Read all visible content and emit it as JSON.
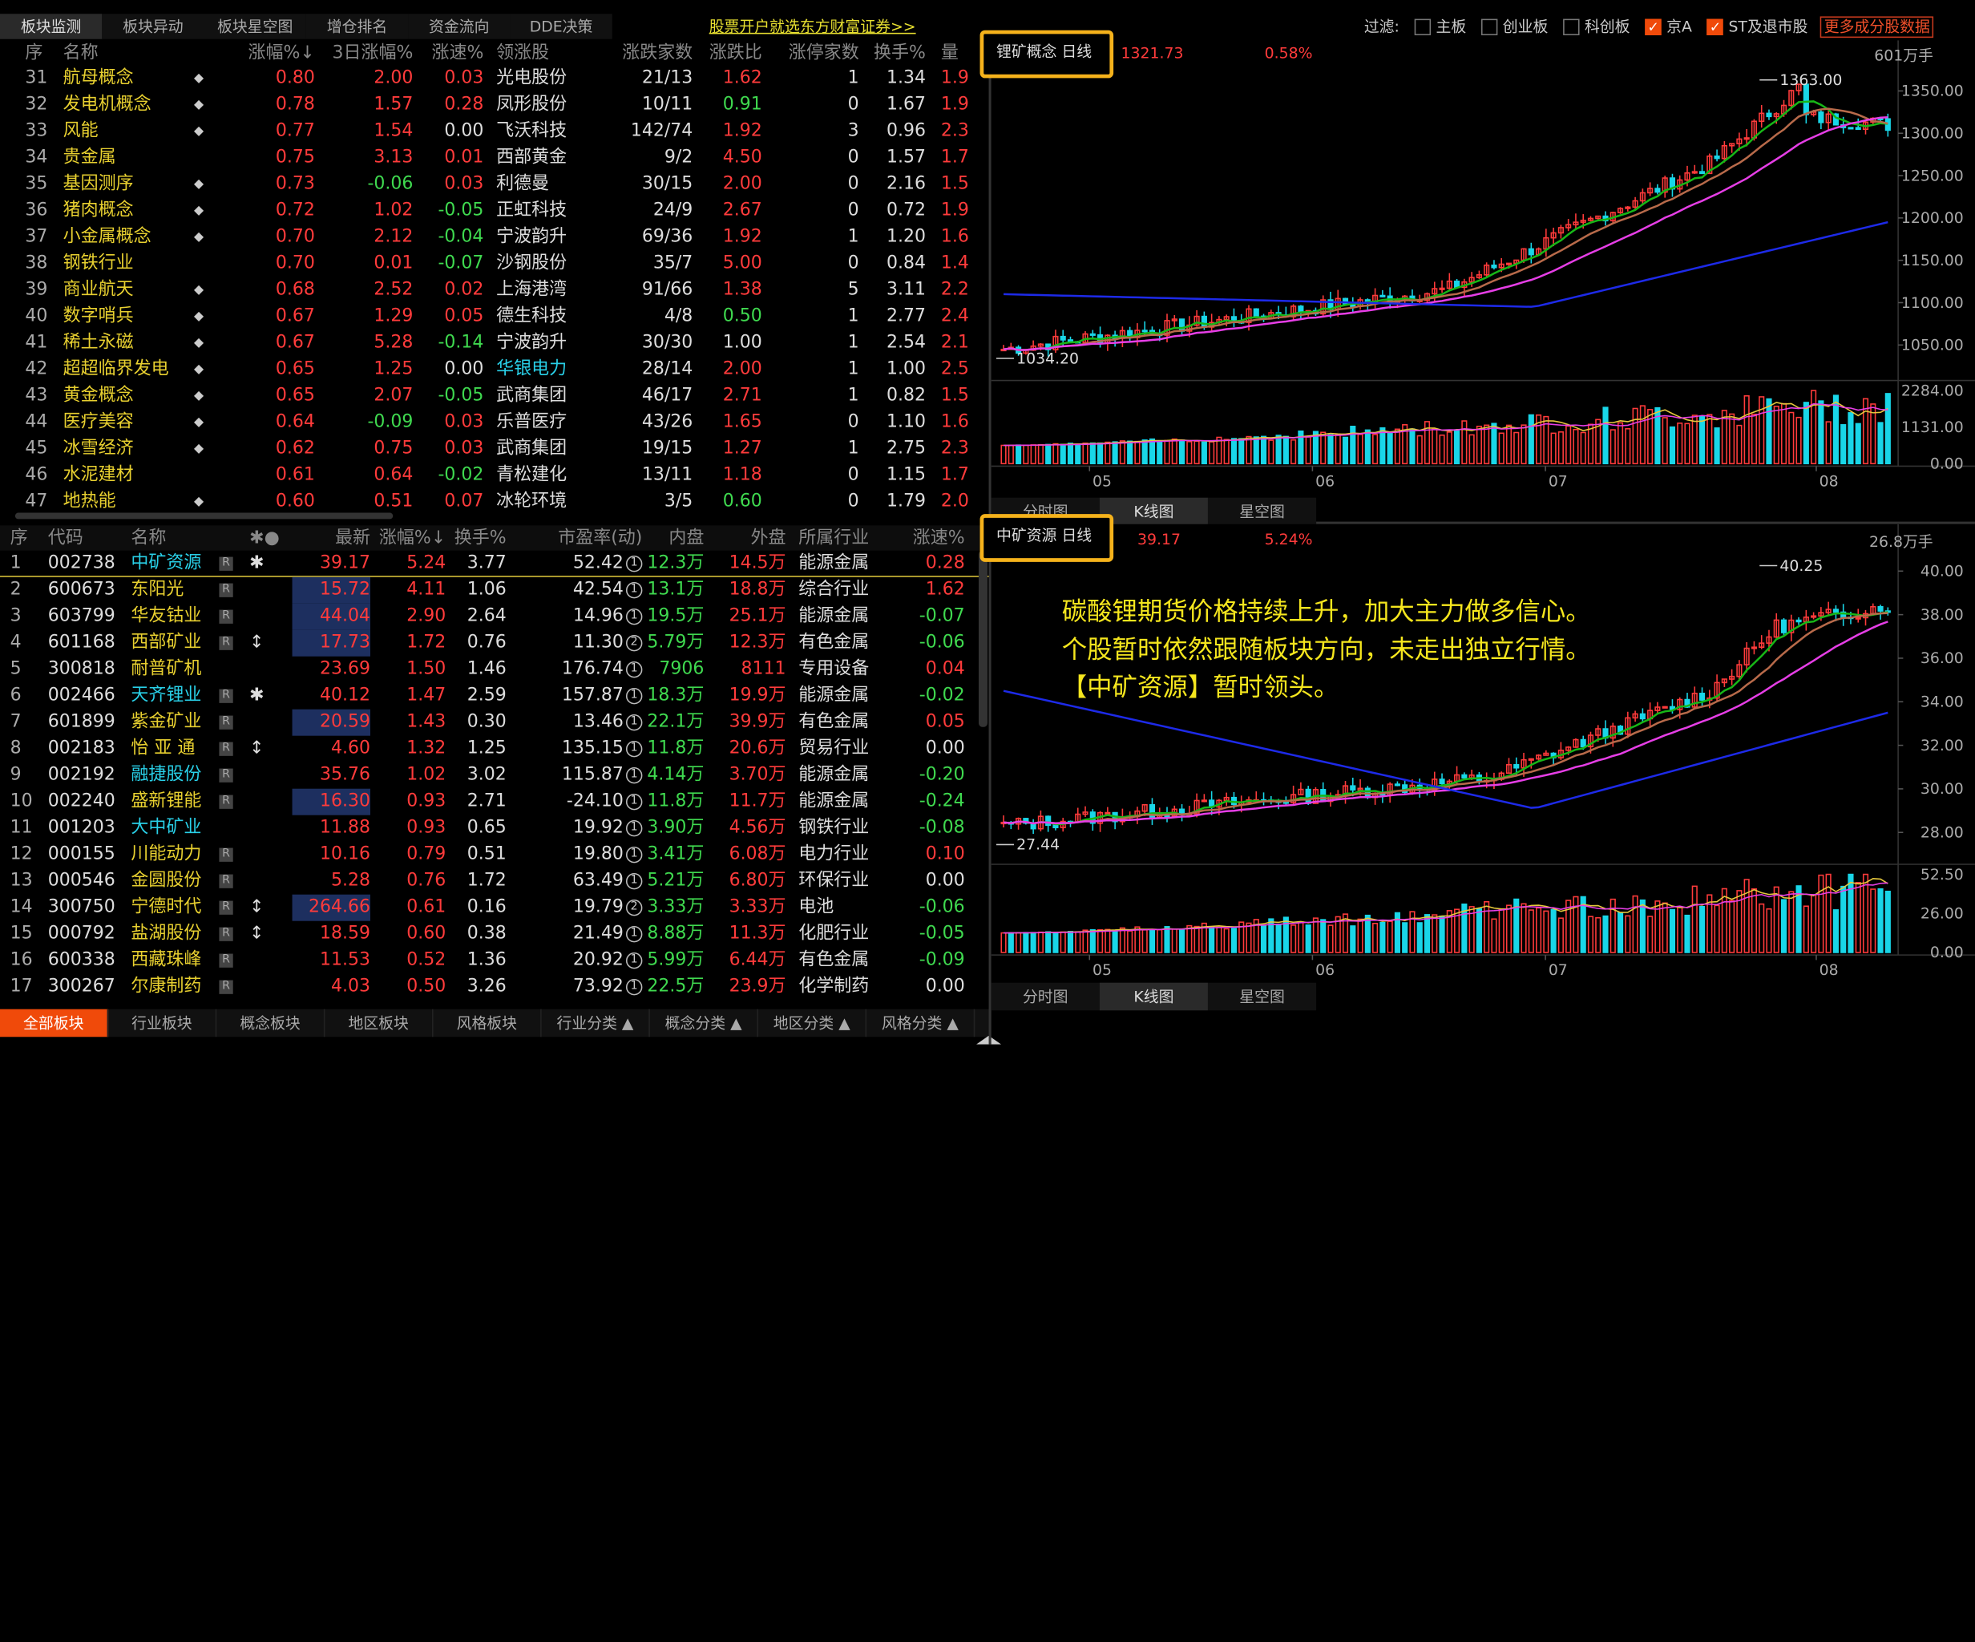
{
  "tabs": [
    "板块监测",
    "板块异动",
    "板块星空图",
    "增仓排名",
    "资金流向",
    "DDE决策"
  ],
  "promo": "股票开户就选东方财富证券>>",
  "filter": {
    "label": "过滤:",
    "items": [
      {
        "label": "主板",
        "checked": false
      },
      {
        "label": "创业板",
        "checked": false
      },
      {
        "label": "科创板",
        "checked": false
      },
      {
        "label": "京A",
        "checked": true
      },
      {
        "label": "ST及退市股",
        "checked": true
      }
    ],
    "more": "更多成分股数据"
  },
  "sector_table": {
    "headers": [
      "序",
      "名称",
      "涨幅%↓",
      "3日涨幅%",
      "涨速%",
      "领涨股",
      "涨跌家数",
      "涨跌比",
      "涨停家数",
      "换手%",
      "量"
    ],
    "rows": [
      {
        "no": "31",
        "name": "航母概念",
        "mark": "◆",
        "pct": "0.80",
        "d3": "2.00",
        "spd": "0.03",
        "lead": "光电股份",
        "cnt": "21/13",
        "ratio": "1.62",
        "zt": "1",
        "turn": "1.34",
        "x": "1.9"
      },
      {
        "no": "32",
        "name": "发电机概念",
        "mark": "◆",
        "pct": "0.78",
        "d3": "1.57",
        "spd": "0.28",
        "lead": "凤形股份",
        "cnt": "10/11",
        "ratio": "0.91",
        "zt": "0",
        "turn": "1.67",
        "x": "1.9"
      },
      {
        "no": "33",
        "name": "风能",
        "mark": "◆",
        "pct": "0.77",
        "d3": "1.54",
        "spd": "0.00",
        "lead": "飞沃科技",
        "cnt": "142/74",
        "ratio": "1.92",
        "zt": "3",
        "turn": "0.96",
        "x": "2.3"
      },
      {
        "no": "34",
        "name": "贵金属",
        "mark": "",
        "pct": "0.75",
        "d3": "3.13",
        "spd": "0.01",
        "lead": "西部黄金",
        "cnt": "9/2",
        "ratio": "4.50",
        "zt": "0",
        "turn": "1.57",
        "x": "1.7"
      },
      {
        "no": "35",
        "name": "基因测序",
        "mark": "◆",
        "pct": "0.73",
        "d3": "-0.06",
        "spd": "0.03",
        "lead": "利德曼",
        "cnt": "30/15",
        "ratio": "2.00",
        "zt": "0",
        "turn": "2.16",
        "x": "1.5"
      },
      {
        "no": "36",
        "name": "猪肉概念",
        "mark": "◆",
        "pct": "0.72",
        "d3": "1.02",
        "spd": "-0.05",
        "lead": "正虹科技",
        "cnt": "24/9",
        "ratio": "2.67",
        "zt": "0",
        "turn": "0.72",
        "x": "1.9"
      },
      {
        "no": "37",
        "name": "小金属概念",
        "mark": "◆",
        "pct": "0.70",
        "d3": "2.12",
        "spd": "-0.04",
        "lead": "宁波韵升",
        "cnt": "69/36",
        "ratio": "1.92",
        "zt": "1",
        "turn": "1.20",
        "x": "1.6"
      },
      {
        "no": "38",
        "name": "钢铁行业",
        "mark": "",
        "pct": "0.70",
        "d3": "0.01",
        "spd": "-0.07",
        "lead": "沙钢股份",
        "cnt": "35/7",
        "ratio": "5.00",
        "zt": "0",
        "turn": "0.84",
        "x": "1.4"
      },
      {
        "no": "39",
        "name": "商业航天",
        "mark": "◆",
        "pct": "0.68",
        "d3": "2.52",
        "spd": "0.02",
        "lead": "上海港湾",
        "cnt": "91/66",
        "ratio": "1.38",
        "zt": "5",
        "turn": "3.11",
        "x": "2.2"
      },
      {
        "no": "40",
        "name": "数字哨兵",
        "mark": "◆",
        "pct": "0.67",
        "d3": "1.29",
        "spd": "0.05",
        "lead": "德生科技",
        "cnt": "4/8",
        "ratio": "0.50",
        "zt": "1",
        "turn": "2.77",
        "x": "2.4"
      },
      {
        "no": "41",
        "name": "稀土永磁",
        "mark": "◆",
        "pct": "0.67",
        "d3": "5.28",
        "spd": "-0.14",
        "lead": "宁波韵升",
        "cnt": "30/30",
        "ratio": "1.00",
        "zt": "1",
        "turn": "2.54",
        "x": "2.1"
      },
      {
        "no": "42",
        "name": "超超临界发电",
        "mark": "◆",
        "pct": "0.65",
        "d3": "1.25",
        "spd": "0.00",
        "lead": "华银电力",
        "cnt": "28/14",
        "ratio": "2.00",
        "zt": "1",
        "turn": "1.00",
        "x": "2.5"
      },
      {
        "no": "43",
        "name": "黄金概念",
        "mark": "◆",
        "pct": "0.65",
        "d3": "2.07",
        "spd": "-0.05",
        "lead": "武商集团",
        "cnt": "46/17",
        "ratio": "2.71",
        "zt": "1",
        "turn": "0.82",
        "x": "1.5"
      },
      {
        "no": "44",
        "name": "医疗美容",
        "mark": "◆",
        "pct": "0.64",
        "d3": "-0.09",
        "spd": "0.03",
        "lead": "乐普医疗",
        "cnt": "43/26",
        "ratio": "1.65",
        "zt": "0",
        "turn": "1.10",
        "x": "1.6"
      },
      {
        "no": "45",
        "name": "冰雪经济",
        "mark": "◆",
        "pct": "0.62",
        "d3": "0.75",
        "spd": "0.03",
        "lead": "武商集团",
        "cnt": "19/15",
        "ratio": "1.27",
        "zt": "1",
        "turn": "2.75",
        "x": "2.3"
      },
      {
        "no": "46",
        "name": "水泥建材",
        "mark": "",
        "pct": "0.61",
        "d3": "0.64",
        "spd": "-0.02",
        "lead": "青松建化",
        "cnt": "13/11",
        "ratio": "1.18",
        "zt": "0",
        "turn": "1.15",
        "x": "1.7"
      },
      {
        "no": "47",
        "name": "地热能",
        "mark": "◆",
        "pct": "0.60",
        "d3": "0.51",
        "spd": "0.07",
        "lead": "冰轮环境",
        "cnt": "3/5",
        "ratio": "0.60",
        "zt": "0",
        "turn": "1.79",
        "x": "2.0"
      }
    ]
  },
  "stock_table": {
    "headers": [
      "序",
      "代码",
      "名称",
      "✱●",
      "最新",
      "涨幅%↓",
      "换手%",
      "市盈率(动)",
      "内盘",
      "外盘",
      "所属行业",
      "涨速%"
    ],
    "rows": [
      {
        "no": "1",
        "code": "002738",
        "name": "中矿资源",
        "r": "R",
        "ic": "✱",
        "price": "39.17",
        "pct": "5.24",
        "turn": "3.77",
        "pe": "52.42",
        "pq": "1",
        "nei": "12.3万",
        "wai": "14.5万",
        "ind": "能源金属",
        "spd": "0.28",
        "hl": false,
        "cyan": true
      },
      {
        "no": "2",
        "code": "600673",
        "name": "东阳光",
        "r": "R",
        "ic": "",
        "price": "15.72",
        "pct": "4.11",
        "turn": "1.06",
        "pe": "42.54",
        "pq": "1",
        "nei": "13.1万",
        "wai": "18.8万",
        "ind": "综合行业",
        "spd": "1.62",
        "hl": true,
        "cyan": false
      },
      {
        "no": "3",
        "code": "603799",
        "name": "华友钴业",
        "r": "R",
        "ic": "",
        "price": "44.04",
        "pct": "2.90",
        "turn": "2.64",
        "pe": "14.96",
        "pq": "1",
        "nei": "19.5万",
        "wai": "25.1万",
        "ind": "能源金属",
        "spd": "-0.07",
        "hl": true,
        "cyan": false
      },
      {
        "no": "4",
        "code": "601168",
        "name": "西部矿业",
        "r": "R",
        "ic": "↕",
        "price": "17.73",
        "pct": "1.72",
        "turn": "0.76",
        "pe": "11.30",
        "pq": "2",
        "nei": "5.79万",
        "wai": "12.3万",
        "ind": "有色金属",
        "spd": "-0.06",
        "hl": true,
        "cyan": false
      },
      {
        "no": "5",
        "code": "300818",
        "name": "耐普矿机",
        "r": "",
        "ic": "",
        "price": "23.69",
        "pct": "1.50",
        "turn": "1.46",
        "pe": "176.74",
        "pq": "1",
        "nei": "7906",
        "wai": "8111",
        "ind": "专用设备",
        "spd": "0.04",
        "hl": false,
        "cyan": false
      },
      {
        "no": "6",
        "code": "002466",
        "name": "天齐锂业",
        "r": "R",
        "ic": "✱",
        "price": "40.12",
        "pct": "1.47",
        "turn": "2.59",
        "pe": "157.87",
        "pq": "1",
        "nei": "18.3万",
        "wai": "19.9万",
        "ind": "能源金属",
        "spd": "-0.02",
        "hl": false,
        "cyan": true
      },
      {
        "no": "7",
        "code": "601899",
        "name": "紫金矿业",
        "r": "R",
        "ic": "",
        "price": "20.59",
        "pct": "1.43",
        "turn": "0.30",
        "pe": "13.46",
        "pq": "1",
        "nei": "22.1万",
        "wai": "39.9万",
        "ind": "有色金属",
        "spd": "0.05",
        "hl": true,
        "cyan": false
      },
      {
        "no": "8",
        "code": "002183",
        "name": "怡 亚 通",
        "r": "R",
        "ic": "↕",
        "price": "4.60",
        "pct": "1.32",
        "turn": "1.25",
        "pe": "135.15",
        "pq": "1",
        "nei": "11.8万",
        "wai": "20.6万",
        "ind": "贸易行业",
        "spd": "0.00",
        "hl": false,
        "cyan": false
      },
      {
        "no": "9",
        "code": "002192",
        "name": "融捷股份",
        "r": "R",
        "ic": "",
        "price": "35.76",
        "pct": "1.02",
        "turn": "3.02",
        "pe": "115.87",
        "pq": "1",
        "nei": "4.14万",
        "wai": "3.70万",
        "ind": "能源金属",
        "spd": "-0.20",
        "hl": false,
        "cyan": true
      },
      {
        "no": "10",
        "code": "002240",
        "name": "盛新锂能",
        "r": "R",
        "ic": "",
        "price": "16.30",
        "pct": "0.93",
        "turn": "2.71",
        "pe": "-24.10",
        "pq": "1",
        "nei": "11.8万",
        "wai": "11.7万",
        "ind": "能源金属",
        "spd": "-0.24",
        "hl": true,
        "cyan": false
      },
      {
        "no": "11",
        "code": "001203",
        "name": "大中矿业",
        "r": "",
        "ic": "",
        "price": "11.88",
        "pct": "0.93",
        "turn": "0.65",
        "pe": "19.92",
        "pq": "1",
        "nei": "3.90万",
        "wai": "4.56万",
        "ind": "钢铁行业",
        "spd": "-0.08",
        "hl": false,
        "cyan": true
      },
      {
        "no": "12",
        "code": "000155",
        "name": "川能动力",
        "r": "R",
        "ic": "",
        "price": "10.16",
        "pct": "0.79",
        "turn": "0.51",
        "pe": "19.80",
        "pq": "1",
        "nei": "3.41万",
        "wai": "6.08万",
        "ind": "电力行业",
        "spd": "0.10",
        "hl": false,
        "cyan": false
      },
      {
        "no": "13",
        "code": "000546",
        "name": "金圆股份",
        "r": "R",
        "ic": "",
        "price": "5.28",
        "pct": "0.76",
        "turn": "1.72",
        "pe": "63.49",
        "pq": "1",
        "nei": "5.21万",
        "wai": "6.80万",
        "ind": "环保行业",
        "spd": "0.00",
        "hl": false,
        "cyan": false
      },
      {
        "no": "14",
        "code": "300750",
        "name": "宁德时代",
        "r": "R",
        "ic": "↕",
        "price": "264.66",
        "pct": "0.61",
        "turn": "0.16",
        "pe": "19.79",
        "pq": "2",
        "nei": "3.33万",
        "wai": "3.33万",
        "ind": "电池",
        "spd": "-0.06",
        "hl": true,
        "cyan": false
      },
      {
        "no": "15",
        "code": "000792",
        "name": "盐湖股份",
        "r": "R",
        "ic": "↕",
        "price": "18.59",
        "pct": "0.60",
        "turn": "0.38",
        "pe": "21.49",
        "pq": "1",
        "nei": "8.88万",
        "wai": "11.3万",
        "ind": "化肥行业",
        "spd": "-0.05",
        "hl": false,
        "cyan": false
      },
      {
        "no": "16",
        "code": "600338",
        "name": "西藏珠峰",
        "r": "R",
        "ic": "",
        "price": "11.53",
        "pct": "0.52",
        "turn": "1.36",
        "pe": "20.92",
        "pq": "1",
        "nei": "5.99万",
        "wai": "6.44万",
        "ind": "有色金属",
        "spd": "-0.09",
        "hl": false,
        "cyan": false
      },
      {
        "no": "17",
        "code": "300267",
        "name": "尔康制药",
        "r": "R",
        "ic": "",
        "price": "4.03",
        "pct": "0.50",
        "turn": "3.26",
        "pe": "73.92",
        "pq": "1",
        "nei": "22.5万",
        "wai": "23.9万",
        "ind": "化学制药",
        "spd": "0.00",
        "hl": false,
        "cyan": false
      }
    ]
  },
  "bottom_tabs": [
    "全部板块",
    "行业板块",
    "概念板块",
    "地区板块",
    "风格板块",
    "行业分类 ▲",
    "概念分类 ▲",
    "地区分类 ▲",
    "风格分类 ▲"
  ],
  "chart_tabs": [
    "分时图",
    "K线图",
    "星空图"
  ],
  "chart1": {
    "title": "锂矿概念 日线",
    "last": "1321.73",
    "chg": "0.58%",
    "vol_unit": "601万手",
    "y_ticks": [
      "1350.00",
      "1300.00",
      "1250.00",
      "1200.00",
      "1150.00",
      "1100.00",
      "1050.00"
    ],
    "vol_ticks": [
      "2284.00",
      "1131.00",
      "0.00"
    ],
    "x_ticks": [
      "05",
      "06",
      "07",
      "08"
    ],
    "hi": "1363.00",
    "lo": "1034.20"
  },
  "chart2": {
    "title": "中矿资源 日线",
    "last": "39.17",
    "chg": "5.24%",
    "vol_unit": "26.8万手",
    "y_ticks": [
      "40.00",
      "38.00",
      "36.00",
      "34.00",
      "32.00",
      "30.00",
      "28.00"
    ],
    "vol_ticks": [
      "52.50",
      "26.00",
      "0.00"
    ],
    "x_ticks": [
      "05",
      "06",
      "07",
      "08"
    ],
    "hi": "40.25",
    "lo": "27.44"
  },
  "note": [
    "碳酸锂期货价格持续上升，加大主力做多信心。",
    "个股暂时依然跟随板块方向，未走出独立行情。",
    "【中矿资源】暂时领头。"
  ],
  "chart_data": [
    {
      "type": "candlestick",
      "title": "锂矿概念 日线",
      "high": 1363.0,
      "low": 1034.2,
      "last": 1321.73,
      "ylim": [
        1020,
        1380
      ]
    },
    {
      "type": "candlestick",
      "title": "中矿资源 日线",
      "high": 40.25,
      "low": 27.44,
      "last": 39.17,
      "ylim": [
        27,
        41
      ]
    }
  ]
}
